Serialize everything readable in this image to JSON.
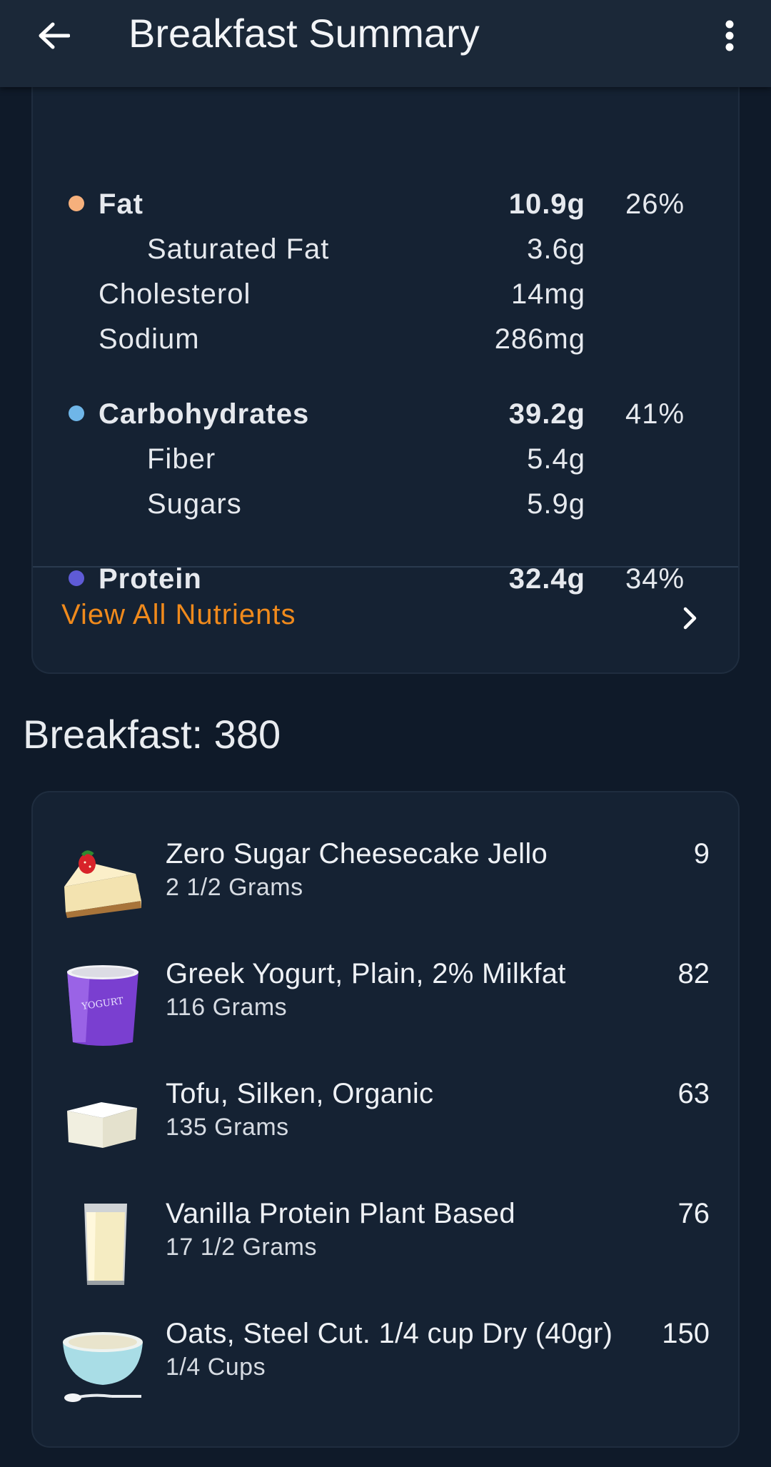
{
  "header": {
    "title": "Breakfast Summary"
  },
  "nutrients": {
    "rows": [
      {
        "label": "Fat",
        "amount": "10.9g",
        "percent": "26%",
        "dot_color": "#f6b07c"
      },
      {
        "label": "Saturated Fat",
        "amount": "3.6g"
      },
      {
        "label": "Cholesterol",
        "amount": "14mg"
      },
      {
        "label": "Sodium",
        "amount": "286mg"
      },
      {
        "label": "Carbohydrates",
        "amount": "39.2g",
        "percent": "41%",
        "dot_color": "#6fb6e8"
      },
      {
        "label": "Fiber",
        "amount": "5.4g"
      },
      {
        "label": "Sugars",
        "amount": "5.9g"
      },
      {
        "label": "Protein",
        "amount": "32.4g",
        "percent": "34%",
        "dot_color": "#5f5bd6"
      }
    ],
    "view_all_label": "View All Nutrients"
  },
  "meal": {
    "title": "Breakfast: 380",
    "items": [
      {
        "name": "Zero Sugar Cheesecake Jello",
        "quantity": "2 1/2 Grams",
        "calories": "9",
        "icon": "cheesecake-icon"
      },
      {
        "name": "Greek Yogurt, Plain, 2% Milkfat",
        "quantity": "116 Grams",
        "calories": "82",
        "icon": "yogurt-cup-icon",
        "icon_text": "YOGURT"
      },
      {
        "name": "Tofu, Silken, Organic",
        "quantity": "135 Grams",
        "calories": "63",
        "icon": "tofu-icon"
      },
      {
        "name": "Vanilla Protein Plant Based",
        "quantity": "17 1/2 Grams",
        "calories": "76",
        "icon": "milk-glass-icon"
      },
      {
        "name": "Oats, Steel Cut. 1/4 cup Dry (40gr)",
        "quantity": "1/4 Cups",
        "calories": "150",
        "icon": "oat-bowl-icon"
      }
    ]
  },
  "colors": {
    "accent": "#f08a1c",
    "background": "#0f1a29",
    "card": "#152233",
    "app_bar": "#1b2838"
  }
}
